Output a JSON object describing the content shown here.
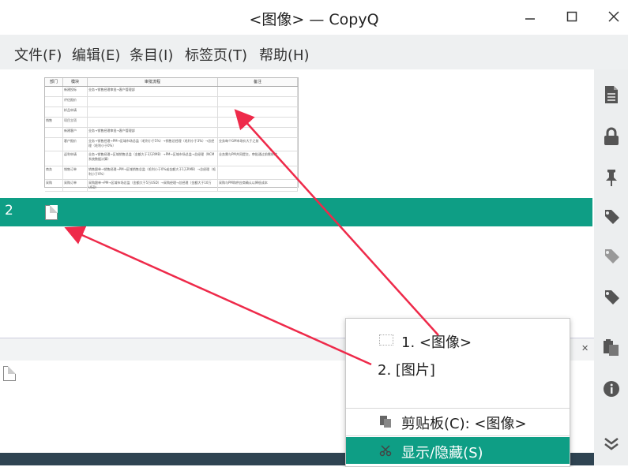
{
  "window": {
    "title": "<图像> — CopyQ"
  },
  "menu": {
    "file": "文件(F)",
    "edit": "编辑(E)",
    "item": "条目(I)",
    "tabs": "标签页(T)",
    "help": "帮助(H)"
  },
  "list": {
    "selected_index": "2"
  },
  "thumbnail": {
    "headers": [
      "部门",
      "模块",
      "审批流程",
      "备注"
    ],
    "rows": [
      [
        "",
        "新建投标",
        "业务→销售经理审批→客户管理部",
        ""
      ],
      [
        "",
        "评估报价",
        "",
        ""
      ],
      [
        "",
        "样品申请",
        "",
        ""
      ],
      [
        "销售",
        "项目立项",
        "",
        ""
      ],
      [
        "",
        "新建客户",
        "业务→销售经理审批→客户管理部",
        ""
      ],
      [
        "",
        "客户报价",
        "业务→销售经理→PM→区域市场总监（毛利小于5%）→销售总经理（毛利小于3%）→总经理（毛利小于0%）",
        "业务每个GM市场价大于之前"
      ],
      [
        "",
        "返利申请",
        "业务→销售经理→区域销售总监（金额大于3万RMB）→PM→区域市场总监→总经理（NCM系统数据计算）",
        "业务需与PM共同提交，审批通过前需修改"
      ],
      [
        "商务",
        "销售订单",
        "销售跟单→销售经理→PM→区域销售总监（毛利小于0%或金额大于1万RMB）→总经理（毛利小于0%）",
        ""
      ],
      [
        "采购",
        "采购订单",
        "采购跟单→PM→区域市场总监（金额大于5万USD）→采购经理→总经理（金额大于10万USD）",
        "采购与PM和供应商确认以降低成本"
      ]
    ]
  },
  "context_menu": {
    "item1": "1. <图像>",
    "item2": "2. [图片]",
    "clipboard": "剪贴板(C): <图像>",
    "show_hide": "显示/隐藏(S)"
  },
  "colors": {
    "accent": "#0e9e85",
    "arrow": "#ee2a4a"
  }
}
